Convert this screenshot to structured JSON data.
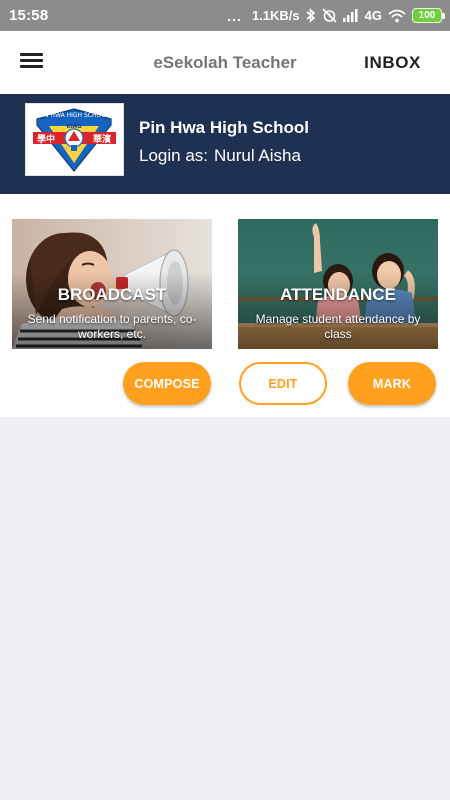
{
  "status_bar": {
    "time": "15:58",
    "dots": "...",
    "speed": "1.1KB/s",
    "network": "4G",
    "battery": "100",
    "colors": {
      "background": "#8c8c8c",
      "battery": "#6fcf3f"
    },
    "icons": [
      "bluetooth-icon",
      "alarm-off-icon",
      "signal-icon",
      "wifi-icon",
      "battery-icon"
    ]
  },
  "app_bar": {
    "title": "eSekolah Teacher",
    "inbox_label": "INBOX",
    "icons": [
      "menu-icon"
    ]
  },
  "school": {
    "name": "Pin Hwa High School",
    "login_prefix": "Login as:",
    "user_name": "Nurul Aisha",
    "logo_text": {
      "top": "PIN HWA HIGH SCHOOL",
      "middle": "KIAG",
      "left": "學中",
      "right": "華濱"
    },
    "colors": {
      "header_bg": "#1f3152"
    }
  },
  "cards": {
    "broadcast": {
      "title": "BROADCAST",
      "description": "Send notification to parents, co-workers, etc.",
      "image": "woman-megaphone-photo"
    },
    "attendance": {
      "title": "ATTENDANCE",
      "description": "Manage student attendance by class",
      "image": "students-raising-hands-photo"
    }
  },
  "buttons": {
    "compose": "COMPOSE",
    "edit": "EDIT",
    "mark": "MARK"
  },
  "colors": {
    "accent": "#ffa01e",
    "page_bg": "#efeff4"
  }
}
